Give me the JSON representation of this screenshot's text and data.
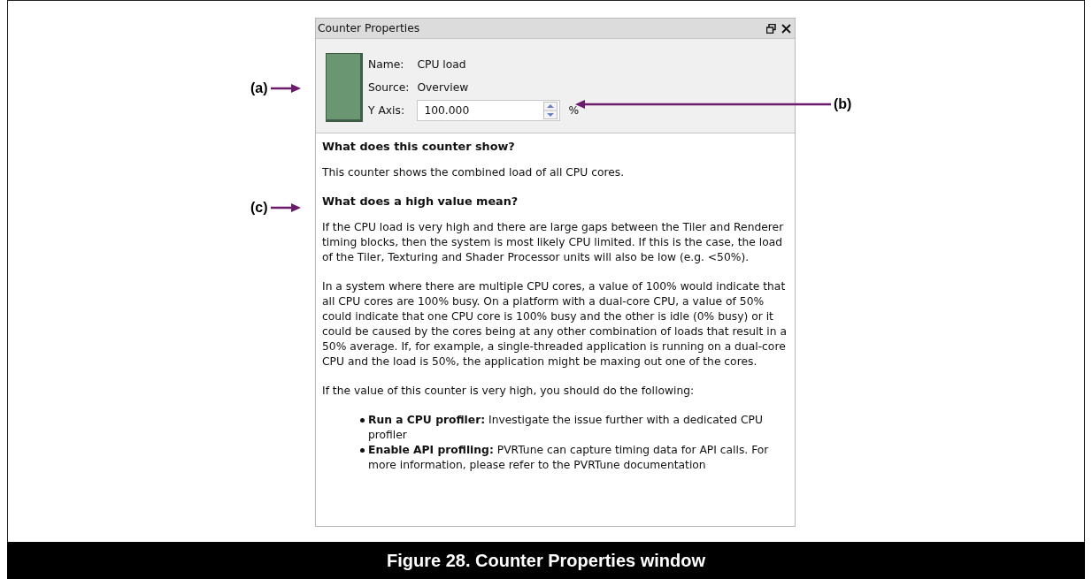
{
  "panel": {
    "title": "Counter Properties",
    "color": "#6a9672",
    "fields": [
      {
        "label": "Name:",
        "value": "CPU load"
      },
      {
        "label": "Source:",
        "value": "Overview"
      }
    ],
    "y_axis": {
      "label": "Y Axis:",
      "value": "100.000",
      "unit": "%"
    }
  },
  "description": [
    {
      "kind": "heading",
      "text": "What does this counter show?"
    },
    {
      "kind": "paragraph",
      "text": "This counter shows the combined load of all CPU cores."
    },
    {
      "kind": "heading",
      "text": "What does a high value mean?"
    },
    {
      "kind": "paragraph",
      "text": "If the CPU load is very high and there are large gaps between the Tiler and Renderer timing blocks, then the system is most likely CPU limited. If this is the case, the load of the Tiler, Texturing and Shader Processor units will also be low (e.g. <50%)."
    },
    {
      "kind": "paragraph",
      "text": "In a system where there are multiple CPU cores, a value of 100% would indicate that all CPU cores are 100% busy. On a platform with a dual-core CPU, a value of 50% could indicate that one CPU core is 100% busy and the other is idle (0% busy) or it could be caused by the cores being at any other combination of loads that result in a 50% average. If, for example, a single-threaded application is running on a dual-core CPU and the load is 50%, the application might be maxing out one of the cores."
    },
    {
      "kind": "paragraph",
      "text": "If the value of this counter is very high, you should do the following:"
    },
    {
      "kind": "bullets",
      "items": [
        "**Run a CPU profiler:** Investigate the issue further with a dedicated CPU profiler",
        "**Enable API profiling:** PVRTune can capture timing data for API calls. For more information, please refer to the PVRTune documentation"
      ]
    }
  ],
  "callouts": [
    {
      "label": "(a)"
    },
    {
      "label": "(b)"
    },
    {
      "label": "(c)"
    }
  ],
  "caption": "Figure 28. Counter Properties window"
}
